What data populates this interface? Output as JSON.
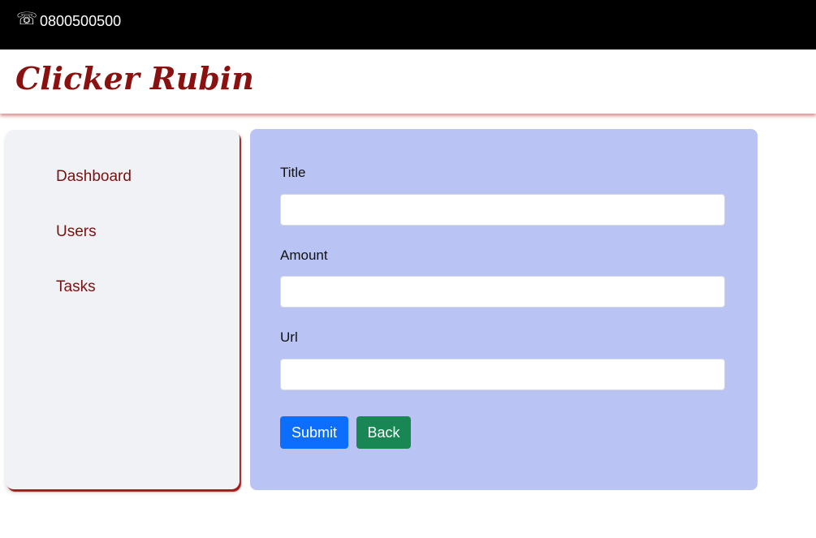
{
  "topbar": {
    "phone_icon": "☏",
    "phone_number": "0800500500"
  },
  "brand": {
    "name": "Clicker Rubin",
    "color": "#8b1010"
  },
  "sidebar": {
    "items": [
      {
        "label": "Dashboard"
      },
      {
        "label": "Users"
      },
      {
        "label": "Tasks"
      }
    ]
  },
  "form": {
    "fields": [
      {
        "label": "Title",
        "value": ""
      },
      {
        "label": "Amount",
        "value": ""
      },
      {
        "label": "Url",
        "value": ""
      }
    ],
    "submit_label": "Submit",
    "back_label": "Back"
  },
  "colors": {
    "panel_bg": "#b9c4f4",
    "sidebar_bg": "#f1f2f6",
    "submit_bg": "#0d6efd",
    "back_bg": "#198754",
    "nav_text": "#7b1010"
  }
}
